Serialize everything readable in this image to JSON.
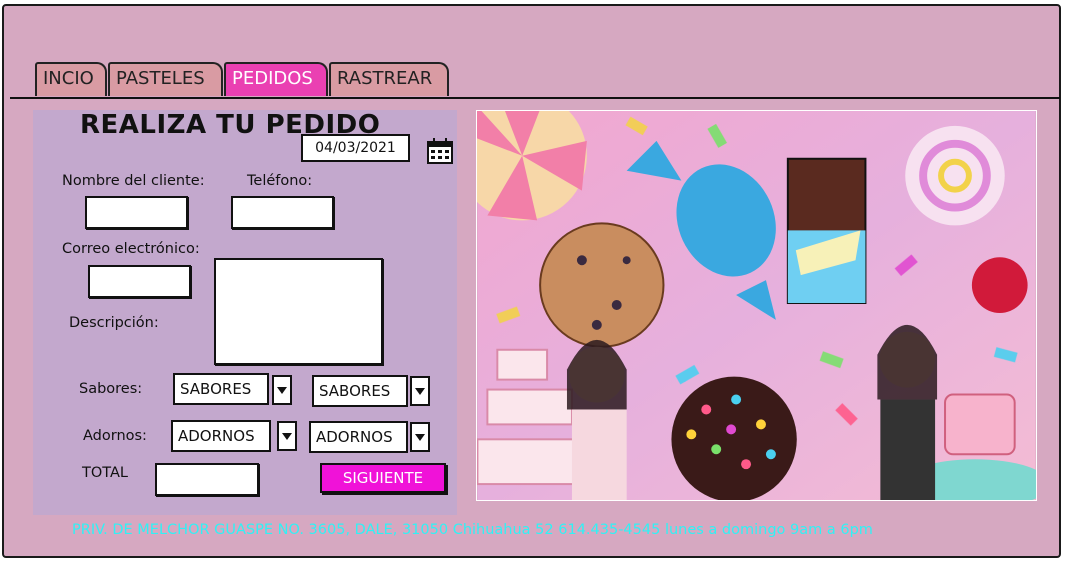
{
  "tabs": [
    {
      "label": "INCIO"
    },
    {
      "label": "PASTELES"
    },
    {
      "label": "PEDIDOS"
    },
    {
      "label": "RASTREAR"
    }
  ],
  "active_tab": "PEDIDOS",
  "form": {
    "title": "REALIZA TU PEDIDO",
    "date": "04/03/2021",
    "client_name_label": "Nombre del cliente:",
    "phone_label": "Teléfono:",
    "email_label": "Correo electrónico:",
    "description_label": "Descripción:",
    "flavors_label": "Sabores:",
    "flavor_1": "SABORES",
    "flavor_2": "SABORES",
    "decorations_label": "Adornos:",
    "decoration_1": "ADORNOS",
    "decoration_2": "ADORNOS",
    "total_label": "TOTAL",
    "next_button": "SIGUIENTE"
  },
  "colors": {
    "background": "#d6a8c1",
    "form_panel": "#c3a8cd",
    "active_tab": "#ea40b2",
    "tab": "#d99ba3",
    "next_button": "#f012d8",
    "footer_text": "#2ff2f5"
  },
  "footer": {
    "text": "PRIV. DE MELCHOR GUASPE NO. 3605, DALE, 31050   Chihuahua 52  614.435-4545 lunes a domingo 9am a 6pm"
  }
}
